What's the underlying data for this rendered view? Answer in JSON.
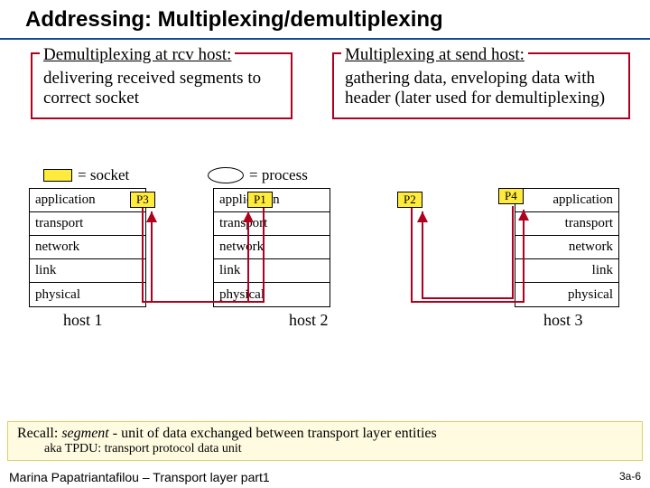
{
  "title": "Addressing: Multiplexing/demultiplexing",
  "demux": {
    "heading": "Demultiplexing at rcv host:",
    "body": "delivering received segments to correct socket"
  },
  "mux": {
    "heading": "Multiplexing at send host:",
    "body": "gathering data, enveloping data with header (later used for demultiplexing)"
  },
  "legend": {
    "socket": "= socket",
    "process": "= process"
  },
  "sockets": {
    "p1": "P1",
    "p2": "P2",
    "p3": "P3",
    "p4": "P4"
  },
  "layers": {
    "application": "application",
    "transport": "transport",
    "network": "network",
    "link": "link",
    "physical": "physical"
  },
  "hosts": {
    "h1": "host 1",
    "h2": "host 2",
    "h3": "host 3"
  },
  "recall": {
    "line1_pre": "Recall: ",
    "line1_ital": "segment",
    "line1_post": " - unit of data exchanged between transport layer entities",
    "line2": "aka TPDU: transport protocol data unit"
  },
  "footer": "Marina Papatriantafilou – Transport layer part1",
  "pageno": "3a-6"
}
